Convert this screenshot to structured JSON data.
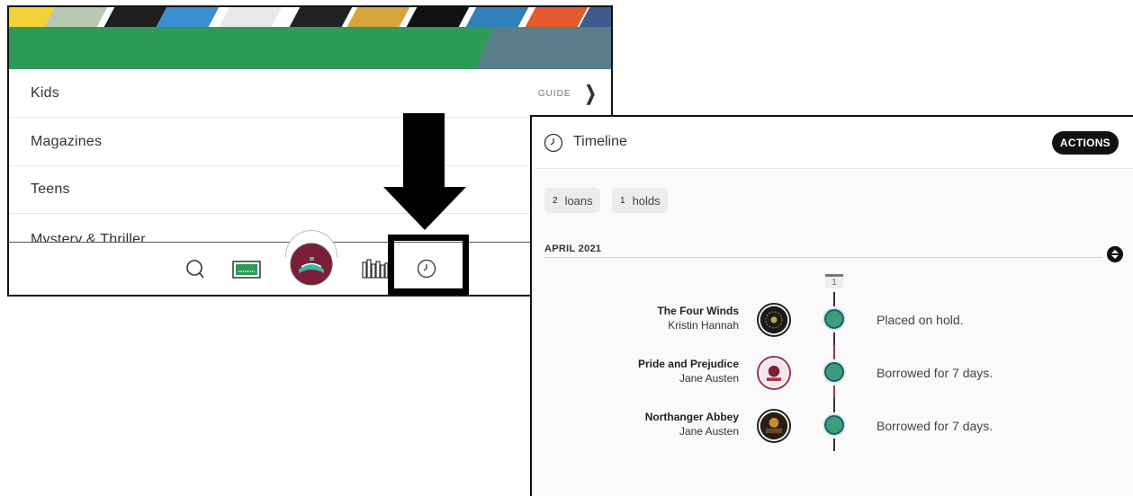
{
  "menu": {
    "items": [
      {
        "label": "Kids",
        "action": "GUIDE"
      },
      {
        "label": "Magazines"
      },
      {
        "label": "Teens"
      },
      {
        "label": "Mystery & Thriller"
      }
    ]
  },
  "bottom_nav": {
    "icons": [
      "search-icon",
      "loans-icon",
      "home-icon",
      "shelf-icon",
      "timeline-icon"
    ],
    "highlighted": "timeline-icon"
  },
  "timeline": {
    "title": "Timeline",
    "actions_label": "ACTIONS",
    "chips": [
      {
        "count": "2",
        "label": "loans"
      },
      {
        "count": "1",
        "label": "holds"
      }
    ],
    "month": "APRIL 2021",
    "day": "1",
    "events": [
      {
        "title": "The Four Winds",
        "author": "Kristin Hannah",
        "description": "Placed on hold.",
        "line_color": "#333333"
      },
      {
        "title": "Pride and Prejudice",
        "author": "Jane Austen",
        "description": "Borrowed for 7 days.",
        "line_color": "#a0334a"
      },
      {
        "title": "Northanger Abbey",
        "author": "Jane Austen",
        "description": "Borrowed for 7 days.",
        "line_color": "#333333"
      }
    ]
  },
  "colors": {
    "banner_green": "#2e9a57",
    "banner_slate": "#5a7d8c",
    "node_green": "#3d9d7a",
    "home_maroon": "#7a1f35"
  }
}
